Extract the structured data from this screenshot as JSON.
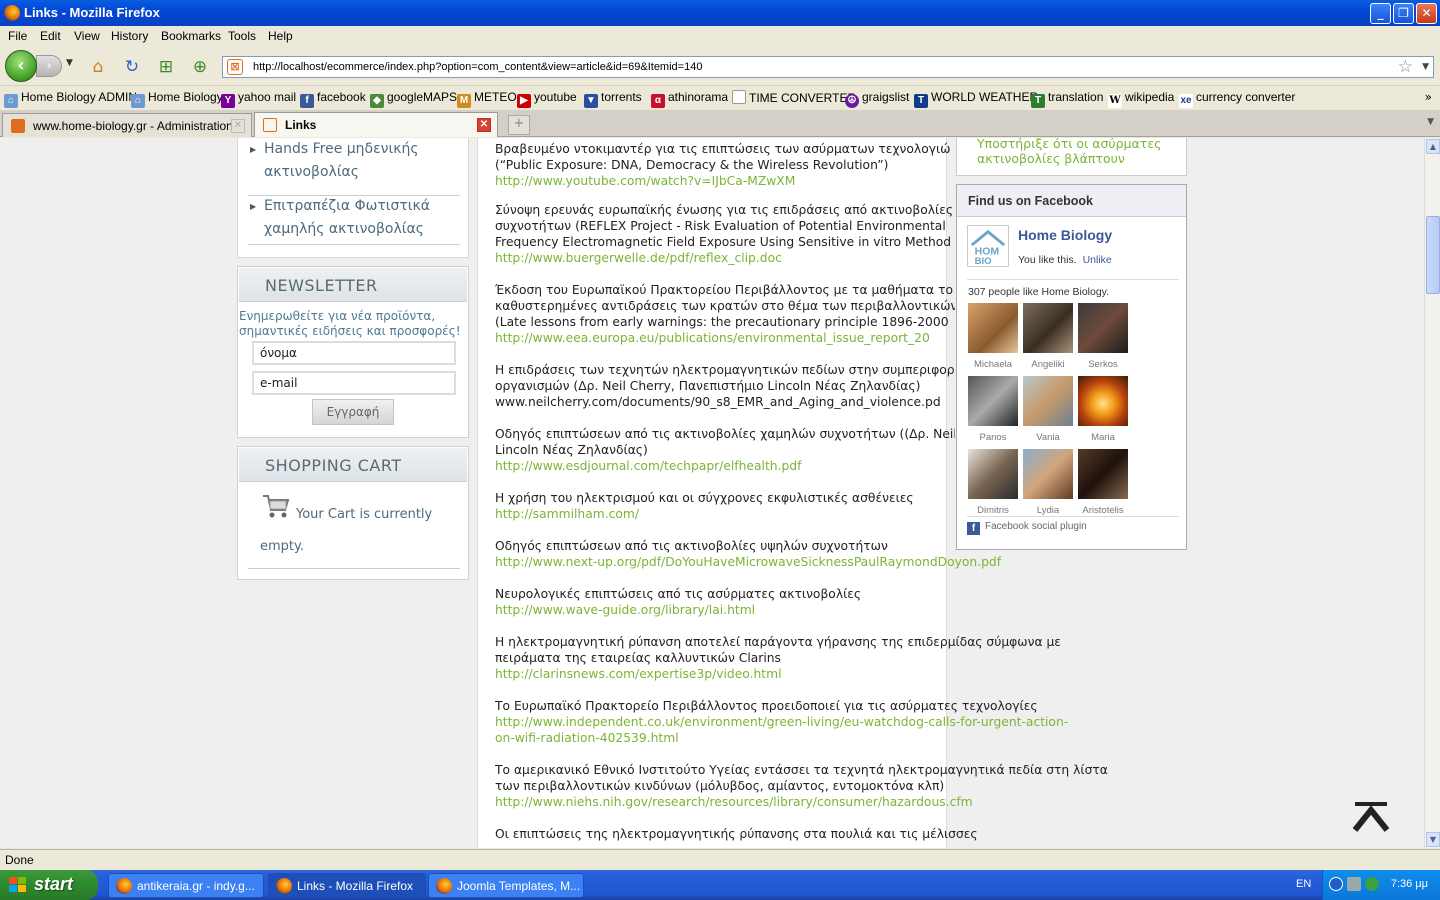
{
  "window": {
    "title": "Links - Mozilla Firefox"
  },
  "menu": [
    "File",
    "Edit",
    "View",
    "History",
    "Bookmarks",
    "Tools",
    "Help"
  ],
  "nav": {
    "url": "http://localhost/ecommerce/index.php?option=com_content&view=article&id=69&Itemid=140"
  },
  "bookmarks": [
    "Home Biology ADMIN",
    "Home Biology",
    "yahoo mail",
    "facebook",
    "googleMAPS",
    "METEO",
    "youtube",
    "torrents",
    "athinorama",
    "TIME CONVERTER",
    "graigslist",
    "WORLD WEATHER",
    "translation",
    "wikipedia",
    "currency converter"
  ],
  "tabs": [
    {
      "label": "www.home-biology.gr - Administration"
    },
    {
      "label": "Links"
    }
  ],
  "left_menu": [
    "Hands Free μηδενικής ακτινοβολίας",
    "Επιτραπέζια Φωτιστικά χαμηλής ακτινοβολίας"
  ],
  "newsletter": {
    "heading": "NEWSLETTER",
    "description": "Ενημερωθείτε για νέα προϊόντα, σημαντικές ειδήσεις και προσφορές!",
    "name_value": "όνομα",
    "email_value": "e-mail",
    "submit": "Εγγραφή"
  },
  "cart": {
    "heading": "SHOPPING CART",
    "message": "Your Cart is currently empty."
  },
  "article": [
    {
      "lines": [
        "Βραβευμένο ντοκιμαντέρ για τις επιπτώσεις των ασύρματων τεχνολογιών",
        "(“Public Exposure: DNA, Democracy & the Wireless Revolution”)"
      ],
      "link": "http://www.youtube.com/watch?v=IJbCa-MZwXM"
    },
    {
      "lines": [
        "Σύνοψη ερευνάς ευρωπαϊκής ένωσης για τις επιδράσεις από ακτινοβολίες χ",
        "συχνοτήτων (REFLEX Project - Risk Evaluation of Potential Environmental",
        "Frequency Electromagnetic Field Exposure Using Sensitive in vitro Method"
      ],
      "link": "http://www.buergerwelle.de/pdf/reflex_clip.doc"
    },
    {
      "lines": [
        "Έκδοση του Ευρωπαϊκού Πρακτορείου Περιβάλλοντος με τα μαθήματα το",
        "καθυστερημένες αντιδράσεις των κρατών στο θέμα των περιβαλλοντικών",
        "(Late lessons from early warnings: the precautionary principle 1896-2000"
      ],
      "link": "http://www.eea.europa.eu/publications/environmental_issue_report_20"
    },
    {
      "lines": [
        "Η επιδράσεις των τεχνητών ηλεκτρομαγνητικών πεδίων στην συμπεριφορ",
        "οργανισμών (Δρ. Neil Cherry, Πανεπιστήμιο Lincoln Νέας Ζηλανδίας)",
        "www.neilcherry.com/documents/90_s8_EMR_and_Aging_and_violence.pd"
      ],
      "link": ""
    },
    {
      "lines": [
        "Οδηγός επιπτώσεων από τις ακτινοβολίες χαμηλών συχνοτήτων ((Δρ. Neil",
        "Lincoln Νέας Ζηλανδίας)"
      ],
      "link": "http://www.esdjournal.com/techpapr/elfhealth.pdf"
    },
    {
      "lines": [
        "Η χρήση του ηλεκτρισμού και οι σύγχρονες εκφυλιστικές ασθένειες"
      ],
      "link": "http://sammilham.com/"
    },
    {
      "lines": [
        "Οδηγός επιπτώσεων από τις ακτινοβολίες υψηλών συχνοτήτων"
      ],
      "link": "http://www.next-up.org/pdf/DoYouHaveMicrowaveSicknessPaulRaymondDoyon.pdf"
    },
    {
      "lines": [
        "Νευρολογικές επιπτώσεις από τις ασύρματες ακτινοβολίες"
      ],
      "link": "http://www.wave-guide.org/library/lai.html"
    },
    {
      "lines": [
        "Η ηλεκτρομαγνητική ρύπανση αποτελεί παράγοντα γήρανσης της επιδερμίδας σύμφωνα με",
        "πειράματα της εταιρείας καλλυντικών Clarins"
      ],
      "link": "http://clarinsnews.com/expertise3p/video.html"
    },
    {
      "lines": [
        "Το Ευρωπαϊκό Πρακτορείο Περιβάλλοντος προειδοποιεί για τις ασύρματες τεχνολογίες"
      ],
      "link": "http://www.independent.co.uk/environment/green-living/eu-watchdog-calls-for-urgent-action-",
      "link2": "on-wifi-radiation-402539.html"
    },
    {
      "lines": [
        "Το αμερικανικό Εθνικό Ινστιτούτο Υγείας εντάσσει τα τεχνητά ηλεκτρομαγνητικά πεδία στη λίστα",
        "των περιβαλλοντικών κινδύνων (μόλυβδος, αμίαντος, εντομοκτόνα κλπ)"
      ],
      "link": "http://www.niehs.nih.gov/research/resources/library/consumer/hazardous.cfm"
    },
    {
      "lines": [
        "Οι επιπτώσεις της ηλεκτρομαγνητικής ρύπανσης στα πουλιά και τις μέλισσες"
      ],
      "link": ""
    }
  ],
  "right_top": {
    "text": "Υποστήριξε ότι οι ασύρματες ακτινοβολίες βλάπτουν"
  },
  "facebook": {
    "heading": "Find us on Facebook",
    "page_name": "Home Biology",
    "you_like": "You like this.",
    "unlike": "Unlike",
    "count_text": "307 people like Home Biology.",
    "fans": [
      "Michaela",
      "Angeliki",
      "Serkos",
      "Panos",
      "Vania",
      "Maria",
      "Dimitris",
      "Lydia",
      "Aristotelis"
    ],
    "plugin": "Facebook social plugin"
  },
  "status": "Done",
  "taskbar": {
    "start": "start",
    "tasks": [
      "antikeraia.gr - indy.g...",
      "Links - Mozilla Firefox",
      "Joomla Templates, M..."
    ],
    "lang": "EN",
    "clock": "7:36 μμ"
  }
}
